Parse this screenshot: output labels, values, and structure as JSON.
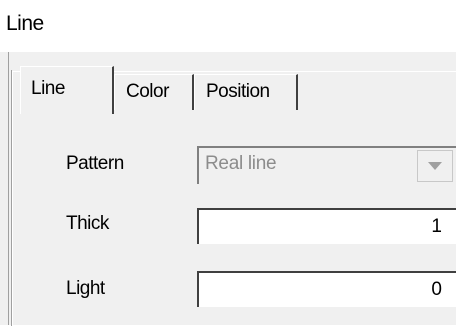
{
  "window": {
    "title": "Line"
  },
  "tabs": [
    {
      "label": "Line",
      "active": true
    },
    {
      "label": "Color",
      "active": false
    },
    {
      "label": "Position",
      "active": false
    }
  ],
  "form": {
    "pattern": {
      "label": "Pattern",
      "value": "Real line"
    },
    "thick": {
      "label": "Thick",
      "value": "1"
    },
    "light": {
      "label": "Light",
      "value": "0"
    }
  },
  "icons": {
    "dropdown": "chevron-down-icon"
  }
}
